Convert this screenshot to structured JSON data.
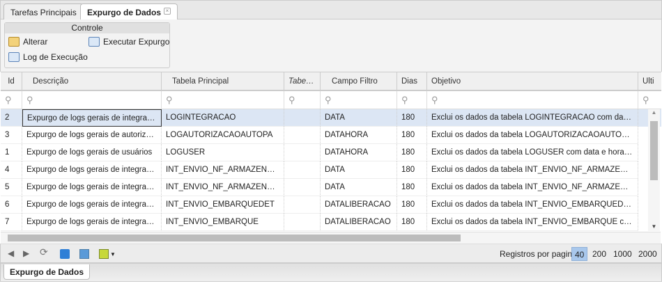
{
  "tabs": [
    {
      "label": "Tarefas Principais"
    },
    {
      "label": "Expurgo de Dados"
    }
  ],
  "control": {
    "title": "Controle",
    "alterar": "Alterar",
    "executar": "Executar Expurgo",
    "log": "Log de Execução"
  },
  "columns": [
    "Id",
    "Descrição",
    "Tabela Principal",
    "Tabelas",
    "Campo Filtro",
    "Dias",
    "Objetivo",
    "Ulti"
  ],
  "rows": [
    {
      "id": "2",
      "descricao": "Expurgo de logs gerais de integração",
      "tabela": "LOGINTEGRACAO",
      "tabelas": "",
      "campo": "DATA",
      "dias": "180",
      "objetivo": "Exclui os dados da tabela LOGINTEGRACAO com data e h..."
    },
    {
      "id": "3",
      "descricao": "Expurgo de logs gerais de autorizaçã...",
      "tabela": "LOGAUTORIZACAOAUTOPA",
      "tabelas": "",
      "campo": "DATAHORA",
      "dias": "180",
      "objetivo": "Exclui os dados da tabela LOGAUTORIZACAOAUTOPA co..."
    },
    {
      "id": "1",
      "descricao": "Expurgo de logs gerais de usuários",
      "tabela": "LOGUSER",
      "tabelas": "",
      "campo": "DATAHORA",
      "dias": "180",
      "objetivo": "Exclui os dados da tabela LOGUSER com data e hora infer..."
    },
    {
      "id": "4",
      "descricao": "Expurgo de logs gerais de integração ...",
      "tabela": "INT_ENVIO_NF_ARMAZENAGE...",
      "tabelas": "",
      "campo": "DATA",
      "dias": "180",
      "objetivo": "Exclui os dados da tabela INT_ENVIO_NF_ARMAZENAGE..."
    },
    {
      "id": "5",
      "descricao": "Expurgo de logs gerais de integração ...",
      "tabela": "INT_ENVIO_NF_ARMAZENAGE...",
      "tabelas": "",
      "campo": "DATA",
      "dias": "180",
      "objetivo": "Exclui os dados da tabela INT_ENVIO_NF_ARMAZENAGE..."
    },
    {
      "id": "6",
      "descricao": "Expurgo de logs gerais de integração ...",
      "tabela": "INT_ENVIO_EMBARQUEDET",
      "tabelas": "",
      "campo": "DATALIBERACAO",
      "dias": "180",
      "objetivo": "Exclui os dados da tabela INT_ENVIO_EMBARQUEDET co..."
    },
    {
      "id": "7",
      "descricao": "Expurgo de logs gerais de integração ...",
      "tabela": "INT_ENVIO_EMBARQUE",
      "tabelas": "",
      "campo": "DATALIBERACAO",
      "dias": "180",
      "objetivo": "Exclui os dados da tabela INT_ENVIO_EMBARQUE com d..."
    }
  ],
  "pager": {
    "label": "Registros por pagina:",
    "options": [
      "40",
      "200",
      "1000",
      "2000"
    ],
    "selected": "40"
  },
  "bottom_tab": "Expurgo de Dados",
  "colors": {
    "selected_row": "#dce6f4"
  }
}
